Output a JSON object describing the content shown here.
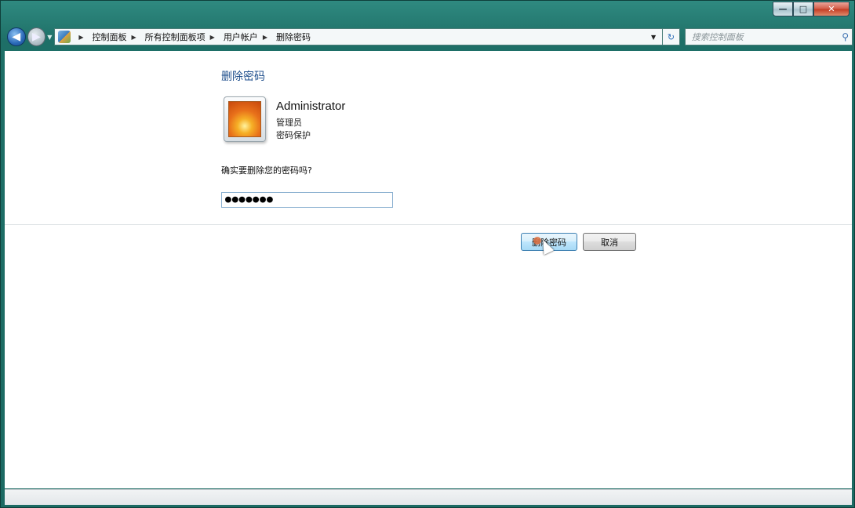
{
  "window": {
    "caption": {
      "minimize": "—",
      "maximize": "□",
      "close": "✕"
    }
  },
  "nav": {
    "back_icon": "back-arrow-icon",
    "forward_icon": "forward-arrow-icon",
    "breadcrumbs": [
      "控制面板",
      "所有控制面板项",
      "用户帐户",
      "删除密码"
    ],
    "search_placeholder": "搜索控制面板"
  },
  "page": {
    "title": "删除密码",
    "user": {
      "name": "Administrator",
      "role": "管理员",
      "protection": "密码保护"
    },
    "question": "确实要删除您的密码吗?",
    "password_value": "●●●●●●●",
    "buttons": {
      "confirm": "删除密码",
      "cancel": "取消"
    }
  },
  "colors": {
    "frame": "#1e6f67",
    "title_text": "#1e4e8c",
    "primary_button": "#bee6fd"
  }
}
